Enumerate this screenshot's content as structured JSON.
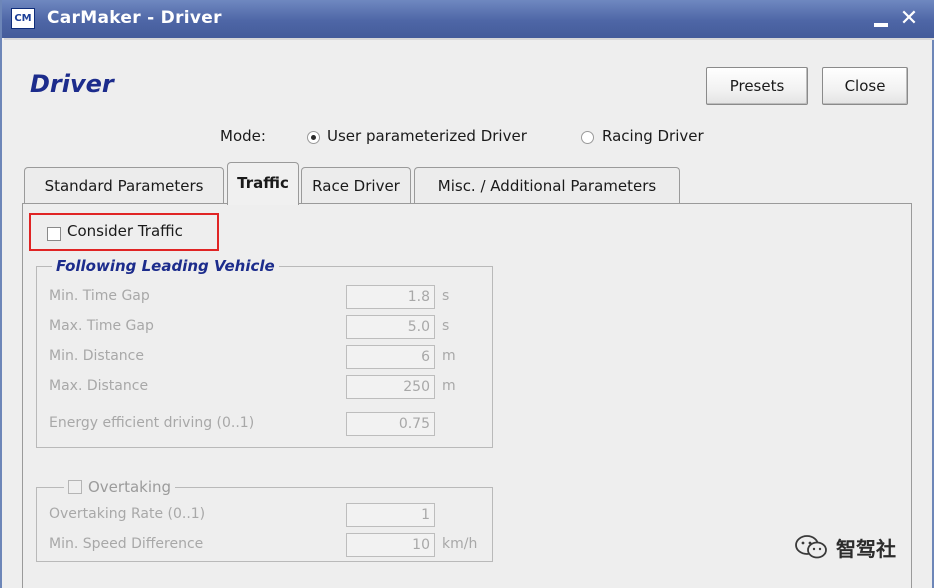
{
  "window": {
    "icon_text": "CM",
    "title": "CarMaker - Driver",
    "minimize": "_",
    "close": "✕"
  },
  "header": {
    "title": "Driver",
    "presets_label": "Presets",
    "close_label": "Close"
  },
  "mode": {
    "label": "Mode:",
    "options": [
      {
        "label": "User parameterized Driver",
        "selected": true
      },
      {
        "label": "Racing Driver",
        "selected": false
      }
    ]
  },
  "tabs": [
    {
      "label": "Standard Parameters",
      "active": false
    },
    {
      "label": "Traffic",
      "active": true
    },
    {
      "label": "Race Driver",
      "active": false
    },
    {
      "label": "Misc. / Additional Parameters",
      "active": false
    }
  ],
  "traffic": {
    "consider_traffic_label": "Consider Traffic",
    "consider_traffic_checked": false,
    "following_group": {
      "title": "Following Leading Vehicle",
      "fields": [
        {
          "label": "Min. Time Gap",
          "value": "1.8",
          "unit": "s"
        },
        {
          "label": "Max. Time Gap",
          "value": "5.0",
          "unit": "s"
        },
        {
          "label": "Min. Distance",
          "value": "6",
          "unit": "m"
        },
        {
          "label": "Max. Distance",
          "value": "250",
          "unit": "m"
        },
        {
          "label": "Energy efficient driving (0..1)",
          "value": "0.75",
          "unit": ""
        }
      ]
    },
    "overtaking_group": {
      "title": "Overtaking",
      "checked": false,
      "fields": [
        {
          "label": "Overtaking Rate (0..1)",
          "value": "1",
          "unit": ""
        },
        {
          "label": "Min. Speed Difference",
          "value": "10",
          "unit": "km/h"
        }
      ]
    }
  },
  "watermark": {
    "text": "智驾社"
  },
  "colors": {
    "titlebar": "#4e66a6",
    "title_text": "#1c2c8c",
    "highlight": "#e02424",
    "disabled_text": "#a8a8a8"
  }
}
